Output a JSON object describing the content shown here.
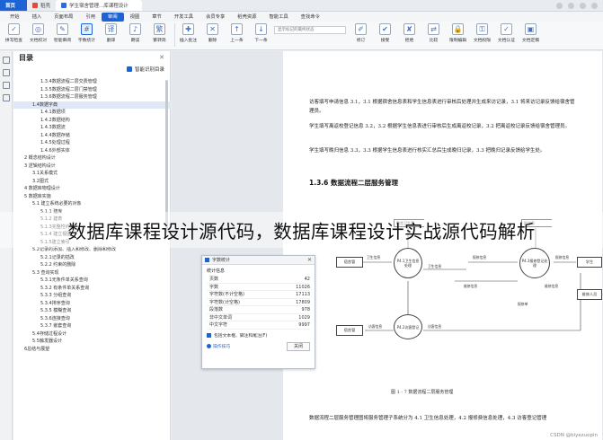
{
  "titlebar": {
    "tabs": [
      {
        "label": "首页",
        "kind": "home"
      },
      {
        "label": "稻壳",
        "kind": "normal"
      },
      {
        "label": "学生宿舍管理...库课程设计",
        "kind": "active"
      }
    ]
  },
  "menubar": {
    "items": [
      "开始",
      "插入",
      "页面布局",
      "引用",
      "审阅",
      "视图",
      "章节",
      "开发工具",
      "会员专享",
      "稻壳资源",
      "智能工具",
      "查找命令"
    ],
    "active_index": 4
  },
  "ribbon": {
    "buttons": [
      {
        "label": "拼写检查",
        "icon": "spellcheck-icon",
        "glyph": "✓"
      },
      {
        "label": "文档校对",
        "icon": "proofread-icon",
        "glyph": "◎"
      },
      {
        "label": "智能审阅",
        "icon": "smart-review-icon",
        "glyph": "✎"
      },
      {
        "label": "字数统计",
        "icon": "word-count-icon",
        "glyph": "#",
        "highlight": true
      },
      {
        "label": "翻译",
        "icon": "translate-icon",
        "glyph": "译"
      },
      {
        "label": "朗读",
        "icon": "read-aloud-icon",
        "glyph": "♪"
      },
      {
        "label": "繁转简",
        "icon": "trad-simp-icon",
        "glyph": "繁"
      },
      {
        "label": "插入批注",
        "icon": "insert-comment-icon",
        "glyph": "✚"
      },
      {
        "label": "删除",
        "icon": "delete-icon",
        "glyph": "✕"
      },
      {
        "label": "上一条",
        "icon": "prev-icon",
        "glyph": "↑"
      },
      {
        "label": "下一条",
        "icon": "next-icon",
        "glyph": "↓"
      },
      {
        "label": "修订",
        "icon": "revise-icon",
        "glyph": "✐"
      },
      {
        "label": "接受",
        "icon": "accept-icon",
        "glyph": "✔"
      },
      {
        "label": "拒绝",
        "icon": "reject-icon",
        "glyph": "✘"
      },
      {
        "label": "比较",
        "icon": "compare-icon",
        "glyph": "⇄"
      },
      {
        "label": "限制编辑",
        "icon": "restrict-icon",
        "glyph": "🔒"
      },
      {
        "label": "文档权限",
        "icon": "permission-icon",
        "glyph": "⚿"
      },
      {
        "label": "文档认证",
        "icon": "certify-icon",
        "glyph": "✓"
      },
      {
        "label": "文档定稿",
        "icon": "finalize-icon",
        "glyph": "▣"
      }
    ],
    "display_mode": "显示标记的最终状态"
  },
  "toc": {
    "title": "目录",
    "smart_label": "智能识别目录",
    "items": [
      {
        "text": "1.3.4数据流程二层交费管理",
        "level": 3
      },
      {
        "text": "1.3.5数据流程二层门禁管理",
        "level": 3
      },
      {
        "text": "1.3.6数据流程二层服务管理",
        "level": 3
      },
      {
        "text": "1.4数据字典",
        "level": 2,
        "selected": true
      },
      {
        "text": "1.4.1数据项",
        "level": 3
      },
      {
        "text": "1.4.2数据结构",
        "level": 3
      },
      {
        "text": "1.4.3数据流",
        "level": 3
      },
      {
        "text": "1.4.4数据存储",
        "level": 3
      },
      {
        "text": "1.4.5处理过程",
        "level": 3
      },
      {
        "text": "1.4.6外部实体",
        "level": 3
      },
      {
        "text": "2 概念结构设计",
        "level": 1
      },
      {
        "text": "3 逻辑结构设计",
        "level": 1
      },
      {
        "text": "3.1关系模式",
        "level": 2
      },
      {
        "text": "3.2图式",
        "level": 2
      },
      {
        "text": "4 数据库物理设计",
        "level": 1
      },
      {
        "text": "5 数据库实施",
        "level": 1
      },
      {
        "text": "5.1 建立系统必要的对象",
        "level": 2
      },
      {
        "text": "5.1.1 建库",
        "level": 3
      },
      {
        "text": "5.1.2 建表",
        "level": 3
      },
      {
        "text": "5.1.3完整性约束",
        "level": 3
      },
      {
        "text": "5.1.4 建立视图",
        "level": 3
      },
      {
        "text": "5.1.5建立索引",
        "level": 3
      },
      {
        "text": "5.2记录的添加、插入和修改、删除和修改",
        "level": 2
      },
      {
        "text": "5.2.1记录的插改",
        "level": 3
      },
      {
        "text": "5.2.2 约束的删除",
        "level": 3
      },
      {
        "text": "5.3 查询实现",
        "level": 2
      },
      {
        "text": "5.3.1无条件单关系查询",
        "level": 3
      },
      {
        "text": "5.3.2 有条件单关系查询",
        "level": 3
      },
      {
        "text": "5.3.3 分组查询",
        "level": 3
      },
      {
        "text": "5.3.4排序查询",
        "level": 3
      },
      {
        "text": "5.3.5 模糊查询",
        "level": 3
      },
      {
        "text": "5.3.6连接查询",
        "level": 3
      },
      {
        "text": "5.3.7 嵌套查询",
        "level": 3
      },
      {
        "text": "5.4存储过程设计",
        "level": 2
      },
      {
        "text": "5.5触发器设计",
        "level": 2
      },
      {
        "text": "6总结与展望",
        "level": 1
      }
    ]
  },
  "document": {
    "para1": "访客填写申请信息 3.1，3.1 根据宿舍信息表和学生信息表进行审核后处理并生成来访记录，3.1 将来访记录反馈给宿舍管理员。",
    "para2": "学生填写离返校登记信息 3.2，3.2 根据学生信息表进行审核后生成离返校记录，3.2 把离返校记录反馈给宿舍管理员。",
    "para3": "学生填写晚归信息 3.3，3.3 根据学生信息表进行核实汇总后生成晚归记录，3.3 把晚归记录反馈给学生处。",
    "heading": "1.3.6 数据流程二层服务管理",
    "caption": "图 1 - 7 数据流程二层服务管理",
    "bottom_para": "数据流程二层服务管理图将服务管理子系统分为 4.1 卫生信息处理，4.2 报修费信息处理，4.3 访客登记管理"
  },
  "dfd": {
    "entities": [
      "宿舍管",
      "宿舍管",
      "学生",
      "维修人员"
    ],
    "processes": [
      "P4.1卫生信息处理",
      "P4.3报修登记处理",
      "P4.2访客登记"
    ],
    "stores": [
      "宿舍卫生表",
      "报修表"
    ],
    "flows": [
      "卫生信息",
      "卫生信息",
      "报修信息",
      "报修信息",
      "维修信息",
      "维修信息",
      "报修单",
      "访客信息",
      "访客信息"
    ]
  },
  "word_count": {
    "title": "字数统计",
    "section": "统计信息",
    "rows": [
      {
        "k": "页数",
        "v": "42"
      },
      {
        "k": "字数",
        "v": "11026"
      },
      {
        "k": "字符数(不计空格)",
        "v": "17113"
      },
      {
        "k": "字符数(计空格)",
        "v": "17809"
      },
      {
        "k": "段落数",
        "v": "978"
      },
      {
        "k": "非中文单词",
        "v": "1029"
      },
      {
        "k": "中文字符",
        "v": "9997"
      }
    ],
    "checkbox_label": "包括文本框、脚注和尾注(F)",
    "link": "操作技巧",
    "close": "关闭"
  },
  "banner": "数据库课程设计源代码，数据库课程设计实战源代码解析",
  "watermark": "CSDN @biyezuopin",
  "colors": {
    "accent": "#1e63d6"
  }
}
